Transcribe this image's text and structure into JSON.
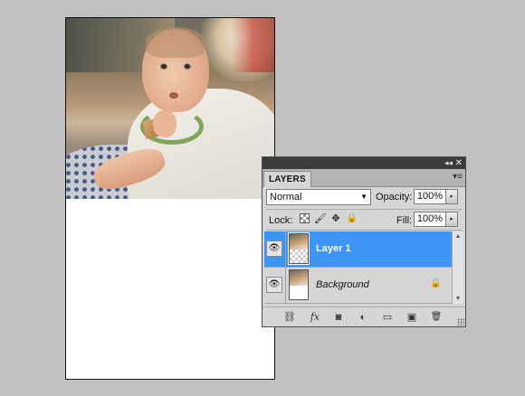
{
  "document": {
    "image": "photo-baby-with-wooden-block"
  },
  "panel": {
    "collapse_glyph": "◂◂",
    "close_glyph": "✕",
    "tab_label": "LAYERS",
    "menu_glyph": "▾≡",
    "blend_mode": "Normal",
    "blend_arrow": "▼",
    "opacity_label": "Opacity:",
    "opacity_value": "100%",
    "fill_label": "Fill:",
    "fill_value": "100%",
    "step_glyph": "▸",
    "lock_label": "Lock:",
    "lock_icons": {
      "image_pixels": "🖌",
      "position": "✥",
      "all": "🔒"
    },
    "layers": [
      {
        "name": "Layer 1",
        "selected": true,
        "visible": true,
        "eye_glyph": "👁"
      },
      {
        "name": "Background",
        "selected": false,
        "visible": true,
        "eye_glyph": "👁",
        "locked": true,
        "lock_glyph": "🔒"
      }
    ],
    "scroll": {
      "up": "▲",
      "down": "▼"
    },
    "footer_icons": {
      "link": "⛓",
      "fx": "fx",
      "mask": "◙",
      "adjustment": "◐",
      "group": "▭",
      "new_layer": "▣",
      "delete": "🗑"
    }
  }
}
